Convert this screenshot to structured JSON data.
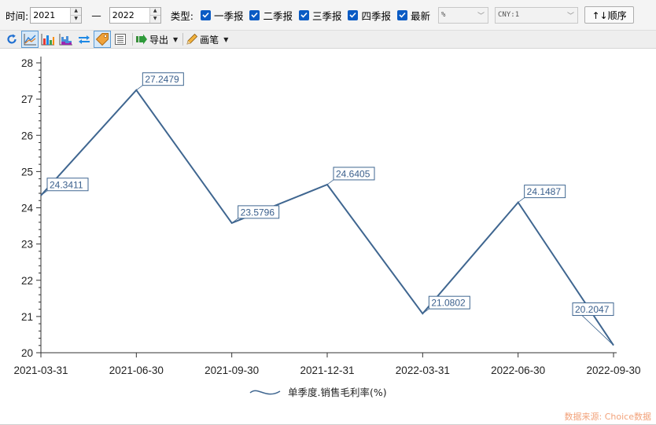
{
  "filter": {
    "time_label": "时间:",
    "start_year": "2021",
    "dash": "—",
    "end_year": "2022",
    "type_label": "类型:",
    "checkboxes": [
      {
        "label": "一季报",
        "checked": true
      },
      {
        "label": "二季报",
        "checked": true
      },
      {
        "label": "三季报",
        "checked": true
      },
      {
        "label": "四季报",
        "checked": true
      },
      {
        "label": "最新",
        "checked": true
      }
    ],
    "unit_select": "%",
    "currency_select": "CNY:1",
    "sort_label": "↑↓顺序"
  },
  "toolbar": {
    "export_label": "导出",
    "pen_label": "画笔",
    "icons": [
      "refresh-icon",
      "line-chart-icon",
      "bar-chart-icon",
      "area-chart-icon",
      "swap-icon",
      "tag-icon",
      "list-icon"
    ]
  },
  "colors": {
    "series": "#3f6690",
    "accent": "#0a5bc4",
    "source_note": "#f2a27a"
  },
  "chart_data": {
    "type": "line",
    "categories": [
      "2021-03-31",
      "2021-06-30",
      "2021-09-30",
      "2021-12-31",
      "2022-03-31",
      "2022-06-30",
      "2022-09-30"
    ],
    "series": [
      {
        "name": "单季度.销售毛利率(%)",
        "values": [
          24.3411,
          27.2479,
          23.5796,
          24.6405,
          21.0802,
          24.1487,
          20.2047
        ]
      }
    ],
    "data_labels": [
      "24.3411",
      "27.2479",
      "23.5796",
      "24.6405",
      "21.0802",
      "24.1487",
      "20.2047"
    ],
    "yticks": [
      "20",
      "21",
      "22",
      "23",
      "24",
      "25",
      "26",
      "27",
      "28"
    ],
    "ylim": [
      20,
      28
    ],
    "grid": false,
    "legend_position": "bottom"
  },
  "source_note": "数据来源: Choice数据"
}
